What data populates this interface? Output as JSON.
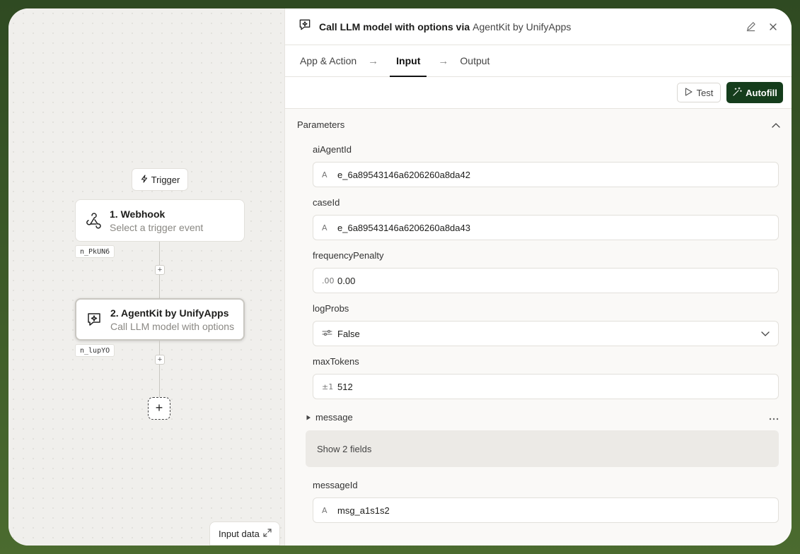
{
  "canvas": {
    "trigger_label": "Trigger",
    "nodes": [
      {
        "title": "1. Webhook",
        "subtitle": "Select a trigger event",
        "tag": "n_PkUN6"
      },
      {
        "title": "2. AgentKit by UnifyApps",
        "subtitle": "Call LLM model with options",
        "tag": "n_lupYO"
      }
    ],
    "input_data_label": "Input data"
  },
  "panel": {
    "title": "Call LLM model with options via",
    "app_name": "AgentKit by UnifyApps",
    "steps": [
      "App & Action",
      "Input",
      "Output"
    ],
    "active_step": "Input",
    "test_label": "Test",
    "autofill_label": "Autofill",
    "section_title": "Parameters",
    "fields": [
      {
        "label": "aiAgentId",
        "type_icon": "A",
        "value": "e_6a89543146a6206260a8da42"
      },
      {
        "label": "caseId",
        "type_icon": "A",
        "value": "e_6a89543146a6206260a8da43"
      },
      {
        "label": "frequencyPenalty",
        "type_icon": ".00",
        "value": "0.00"
      },
      {
        "label": "logProbs",
        "type_icon": "toggle",
        "value": "False"
      },
      {
        "label": "maxTokens",
        "type_icon": "±1",
        "value": "512"
      }
    ],
    "message": {
      "label": "message",
      "show_fields": "Show 2 fields"
    },
    "messageId": {
      "label": "messageId",
      "type_icon": "A",
      "value": "msg_a1s1s2"
    }
  }
}
